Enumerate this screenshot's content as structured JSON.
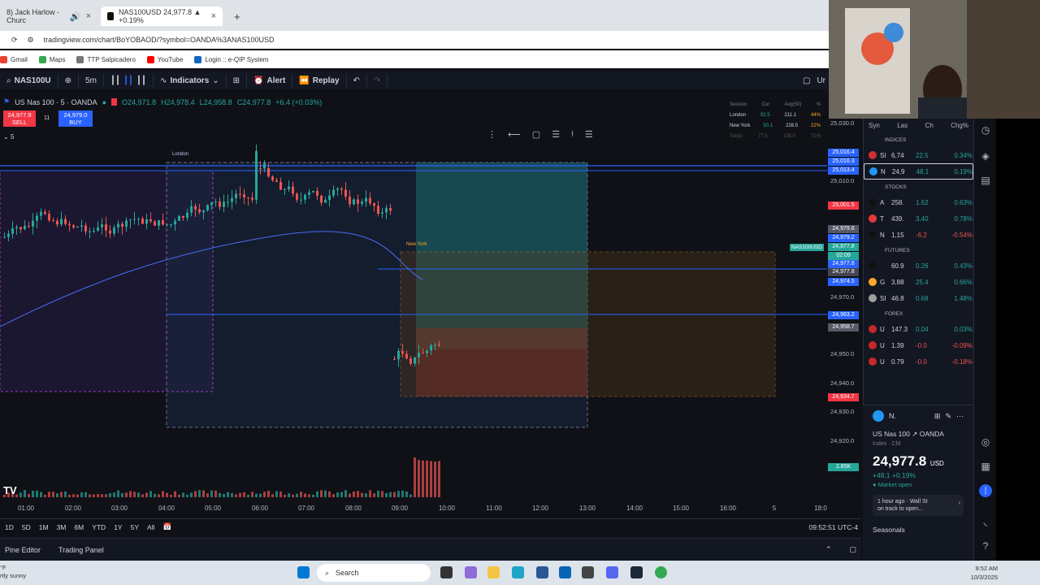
{
  "browser": {
    "tabs": [
      {
        "label": "8) Jack Harlow - Churc"
      },
      {
        "label": "NAS100USD 24,977.8 ▲ +0.19%"
      }
    ],
    "url": "tradingview.com/chart/BoYOBAOD/?symbol=OANDA%3ANAS100USD",
    "bookmarks": [
      "Gmail",
      "Maps",
      "TTP Salpicadero",
      "YouTube",
      "Login :: e-QIP System"
    ]
  },
  "toolbar": {
    "symbol": "NAS100U",
    "interval": "5m",
    "indicators": "Indicators",
    "alert": "Alert",
    "replay": "Replay",
    "right": "Ur"
  },
  "legend": {
    "title": "US Nas 100 · 5 · OANDA",
    "o": "O24,971.8",
    "h": "H24,978.4",
    "l": "L24,958.8",
    "c": "C24,977.8",
    "change": "+6.4 (+0.03%)",
    "sell_price": "24,977.9",
    "sell_label": "SELL",
    "spread": "11",
    "buy_price": "24,979.0",
    "buy_label": "BUY",
    "count": "5"
  },
  "session_table": {
    "headers": [
      "Session",
      "Cur",
      "Avg(50)",
      "%"
    ],
    "rows": [
      [
        "London",
        "92.5",
        "211.1",
        "44%"
      ],
      [
        "New York",
        "50.1",
        "228.5",
        "22%"
      ],
      [
        "Tokyo",
        "77.5",
        "108.0",
        "71%"
      ]
    ]
  },
  "chart_labels": {
    "london": "London",
    "new_york": "New York",
    "ticker_badge": "NAS100USD"
  },
  "yaxis": {
    "labels": [
      "25,030.0",
      "25,010.0",
      "24,970.0",
      "24,950.0",
      "24,940.0",
      "24,930.0",
      "24,920.0"
    ],
    "badges": [
      {
        "text": "25,016.4",
        "color": "#2962ff"
      },
      {
        "text": "25,016.3",
        "color": "#2962ff"
      },
      {
        "text": "25,013.4",
        "color": "#2962ff"
      },
      {
        "text": "25,001.5",
        "color": "#f23645"
      },
      {
        "text": "24,979.6",
        "color": "#555a66"
      },
      {
        "text": "24,979.2",
        "color": "#2962ff"
      },
      {
        "text": "24,977.8",
        "color": "#26a69a"
      },
      {
        "text": "02:09",
        "color": "#26a69a"
      },
      {
        "text": "24,977.8",
        "color": "#2962ff"
      },
      {
        "text": "24,977.8",
        "color": "#434651"
      },
      {
        "text": "24,974.5",
        "color": "#2962ff"
      },
      {
        "text": "24,963.2",
        "color": "#2962ff"
      },
      {
        "text": "24,958.7",
        "color": "#555a66"
      },
      {
        "text": "24,934.7",
        "color": "#f23645"
      },
      {
        "text": "2.85K",
        "color": "#26a69a"
      }
    ]
  },
  "xaxis": [
    "01:00",
    "02:00",
    "03:00",
    "04:00",
    "05:00",
    "06:00",
    "07:00",
    "08:00",
    "09:00",
    "10:00",
    "11:00",
    "12:00",
    "13:00",
    "14:00",
    "15:00",
    "16:00",
    "5",
    "18:0"
  ],
  "periods": [
    "1D",
    "5D",
    "1M",
    "3M",
    "6M",
    "YTD",
    "1Y",
    "5Y",
    "All"
  ],
  "clock": "09:52:51 UTC-4",
  "bottom_tabs": [
    "Pine Editor",
    "Trading Panel"
  ],
  "watchlist": {
    "headers": [
      "Syn",
      "Las",
      "Ch",
      "Chg%"
    ],
    "sections": [
      {
        "name": "INDICES",
        "rows": [
          {
            "sym": "SI",
            "last": "6,74",
            "chg": "22.5",
            "pct": "0.34%",
            "dir": "up",
            "icon": "#d32f2f"
          },
          {
            "sym": "N",
            "last": "24,9",
            "chg": "48.1",
            "pct": "0.19%",
            "dir": "up",
            "icon": "#2196f3"
          }
        ]
      },
      {
        "name": "STOCKS",
        "rows": [
          {
            "sym": "A",
            "last": "258.",
            "chg": "1.62",
            "pct": "0.63%",
            "dir": "up",
            "icon": "#111"
          },
          {
            "sym": "T",
            "last": "439.",
            "chg": "3.40",
            "pct": "0.78%",
            "dir": "up",
            "icon": "#e53935"
          },
          {
            "sym": "N",
            "last": "1,15",
            "chg": "-6.2",
            "pct": "-0.54%",
            "dir": "dn",
            "icon": "#111"
          }
        ]
      },
      {
        "name": "FUTURES",
        "rows": [
          {
            "sym": "",
            "last": "60.9",
            "chg": "0.26",
            "pct": "0.43%",
            "dir": "up",
            "icon": "#111"
          },
          {
            "sym": "G",
            "last": "3,88",
            "chg": "25.4",
            "pct": "0.66%",
            "dir": "up",
            "icon": "#f9a825"
          },
          {
            "sym": "SI",
            "last": "46.8",
            "chg": "0.68",
            "pct": "1.48%",
            "dir": "up",
            "icon": "#9e9e9e"
          }
        ]
      },
      {
        "name": "FOREX",
        "rows": [
          {
            "sym": "U",
            "last": "147.3",
            "chg": "0.04",
            "pct": "0.03%",
            "dir": "up",
            "icon": "#c62828"
          },
          {
            "sym": "U",
            "last": "1.39",
            "chg": "-0.0",
            "pct": "-0.09%",
            "dir": "dn",
            "icon": "#c62828"
          },
          {
            "sym": "U",
            "last": "0.79",
            "chg": "-0.0",
            "pct": "-0.18%",
            "dir": "dn",
            "icon": "#c62828"
          }
        ]
      }
    ]
  },
  "details": {
    "short": "N.",
    "name": "US Nas 100",
    "exchange": "OANDA",
    "type": "Index · Cfd",
    "price": "24,977.8",
    "currency": "USD",
    "change": "+48.1 +0.19%",
    "status": "Market open",
    "news_time": "1 hour ago · Wall St",
    "news_text": "on track to open...",
    "seasonals": "Seasonals"
  },
  "taskbar": {
    "weather": "rtly sunny",
    "search": "Search",
    "time": "9:52 AM",
    "date": "10/3/2025"
  },
  "colors": {
    "up": "#26a69a",
    "down": "#ef5350",
    "accent": "#2962ff"
  }
}
